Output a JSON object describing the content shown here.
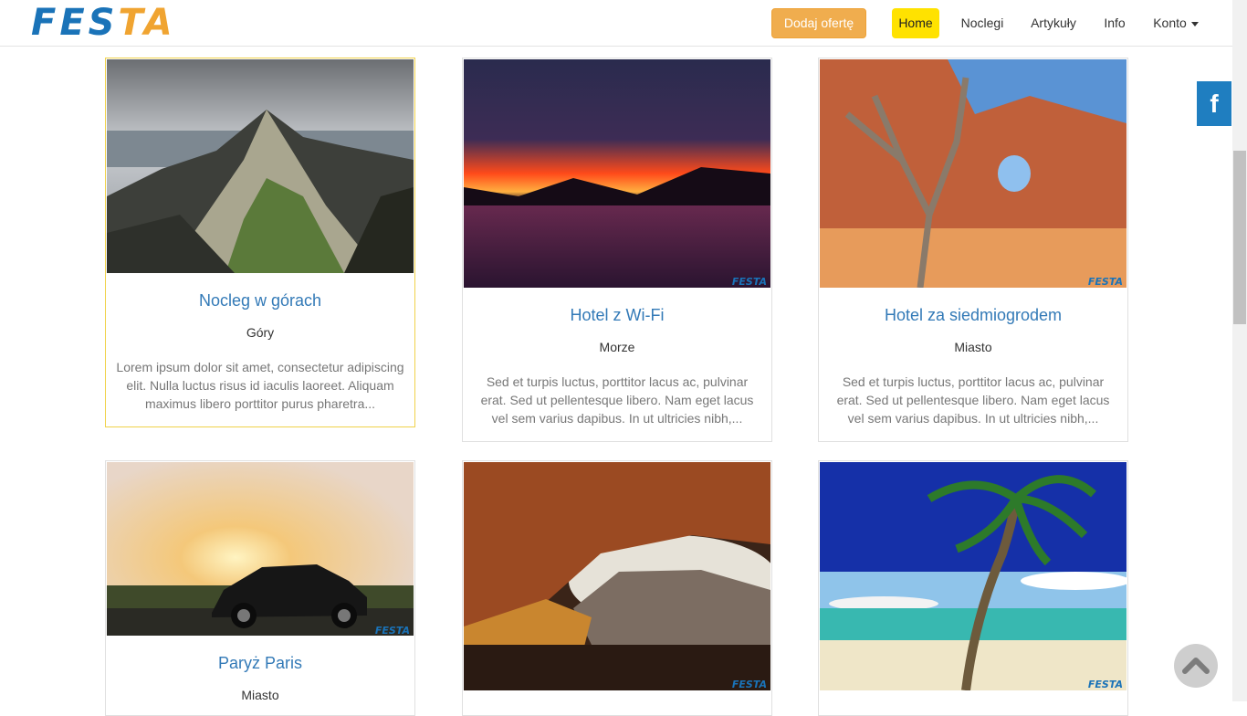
{
  "logo": {
    "part1": "FES",
    "part2": "TA"
  },
  "nav": {
    "add_offer": "Dodaj ofertę",
    "items": [
      {
        "label": "Home"
      },
      {
        "label": "Noclegi"
      },
      {
        "label": "Artykuły"
      },
      {
        "label": "Info"
      },
      {
        "label": "Konto"
      }
    ]
  },
  "facebook": {
    "icon": "f"
  },
  "watermark": "FESTA",
  "cards": [
    {
      "title": "Nocleg w górach",
      "category": "Góry",
      "description": "Lorem ipsum dolor sit amet, consectetur adipiscing elit. Nulla luctus risus id iaculis laoreet. Aliquam maximus libero porttitor purus pharetra..."
    },
    {
      "title": "Hotel z Wi-Fi",
      "category": "Morze",
      "description": "Sed et turpis luctus, porttitor lacus ac, pulvinar erat. Sed ut pellentesque libero. Nam eget lacus vel sem varius dapibus. In ut ultricies nibh,..."
    },
    {
      "title": "Hotel za siedmiogrodem",
      "category": "Miasto",
      "description": "Sed et turpis luctus, porttitor lacus ac, pulvinar erat. Sed ut pellentesque libero. Nam eget lacus vel sem varius dapibus. In ut ultricies nibh,..."
    },
    {
      "title": "Paryż Paris",
      "category": "Miasto",
      "description": ""
    }
  ],
  "colors": {
    "accent": "#337ab7",
    "active_nav": "#ffe200",
    "offer_button": "#f0ad4e"
  }
}
